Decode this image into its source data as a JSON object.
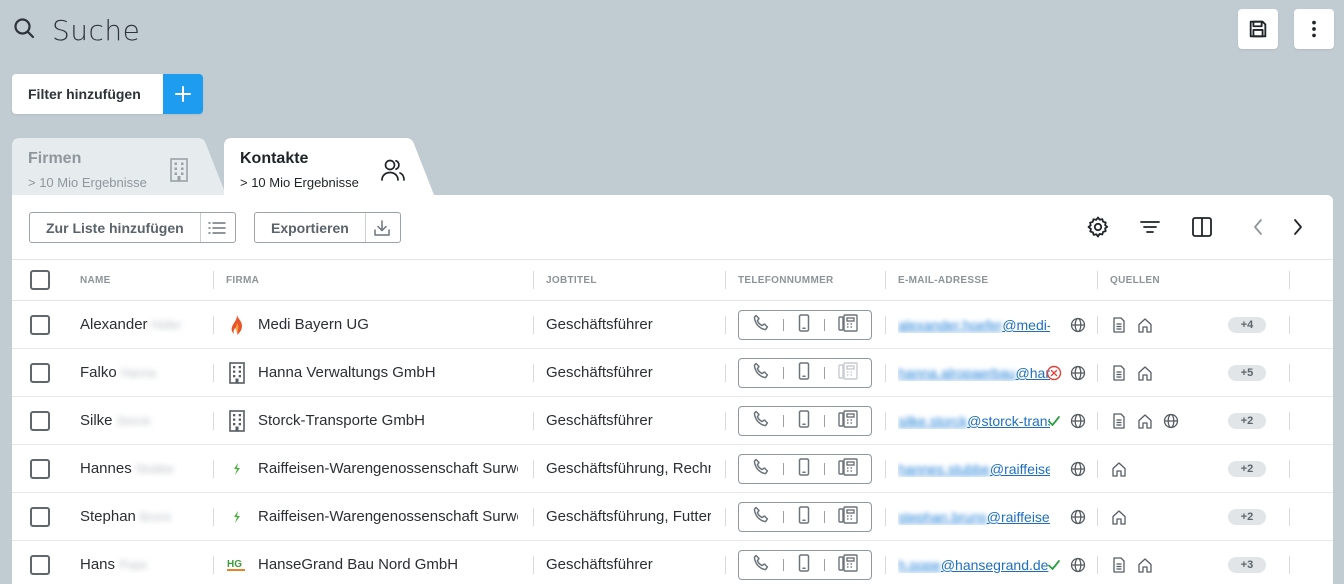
{
  "header": {
    "title": "Suche",
    "icon": "search-icon"
  },
  "top_actions": [
    {
      "name": "save-icon"
    },
    {
      "name": "more-vertical-icon"
    }
  ],
  "filter": {
    "label": "Filter hinzufügen",
    "plus_icon": "plus-icon"
  },
  "tabs": [
    {
      "name": "Firmen",
      "sub": "> 10 Mio Ergebnisse",
      "icon": "building-icon",
      "active": false
    },
    {
      "name": "Kontakte",
      "sub": "> 10 Mio Ergebnisse",
      "icon": "users-icon",
      "active": true
    }
  ],
  "toolbar": {
    "add_to_list": "Zur Liste hinzufügen",
    "export": "Exportieren",
    "icons": [
      "gear-icon",
      "filter-lines-icon",
      "columns-icon",
      "chevron-left-icon",
      "chevron-right-icon"
    ]
  },
  "columns": [
    "NAME",
    "FIRMA",
    "JOBTITEL",
    "TELEFONNUMMER",
    "E-MAIL-ADRESSE",
    "QUELLEN"
  ],
  "rows": [
    {
      "first": "Alexander",
      "last": "Hüfer",
      "company": "Medi Bayern UG",
      "logo": "flame",
      "job": "Geschäftsführer",
      "fax_active": true,
      "email_local": "alexander.hoefer",
      "email_domain": "@medi-bayern",
      "email_status": "none",
      "sources": [
        "doc",
        "home"
      ],
      "badge": "+4"
    },
    {
      "first": "Falko",
      "last": "Hanna",
      "company": "Hanna Verwaltungs GmbH",
      "logo": "building",
      "job": "Geschäftsführer",
      "fax_active": false,
      "email_local": "hanna.alropaerbau",
      "email_domain": "@hanna",
      "email_status": "invalid",
      "sources": [
        "doc",
        "home"
      ],
      "badge": "+5"
    },
    {
      "first": "Silke",
      "last": "Storck",
      "company": "Storck-Transporte GmbH",
      "logo": "building",
      "job": "Geschäftsführer",
      "fax_active": true,
      "email_local": "silke.storck",
      "email_domain": "@storck-transporte",
      "email_status": "valid",
      "sources": [
        "doc",
        "home",
        "globe"
      ],
      "badge": "+2"
    },
    {
      "first": "Hannes",
      "last": "Stubbe",
      "company": "Raiffeisen-Warengenossenschaft Surwold",
      "logo": "leaf",
      "job": "Geschäftsführung, Rechnungswesen",
      "fax_active": true,
      "email_local": "hannes.stubbe",
      "email_domain": "@raiffeisen",
      "email_status": "none",
      "sources": [
        "home"
      ],
      "badge": "+2"
    },
    {
      "first": "Stephan",
      "last": "Bruns",
      "company": "Raiffeisen-Warengenossenschaft Surwold",
      "logo": "leaf",
      "job": "Geschäftsführung, Futtermittel",
      "fax_active": true,
      "email_local": "stephan.bruns",
      "email_domain": "@raiffeisen",
      "email_status": "none",
      "sources": [
        "home"
      ],
      "badge": "+2"
    },
    {
      "first": "Hans",
      "last": "Pope",
      "company": "HanseGrand Bau Nord GmbH",
      "logo": "hg",
      "job": "Geschäftsführer",
      "fax_active": true,
      "email_local": "h.pope",
      "email_domain": "@hansegrand.de",
      "email_status": "valid",
      "sources": [
        "doc",
        "home"
      ],
      "badge": "+3"
    }
  ],
  "colors": {
    "accent": "#1e9cf0",
    "background": "#c1ccd2",
    "valid": "#2e9e44",
    "invalid": "#e0423a"
  }
}
